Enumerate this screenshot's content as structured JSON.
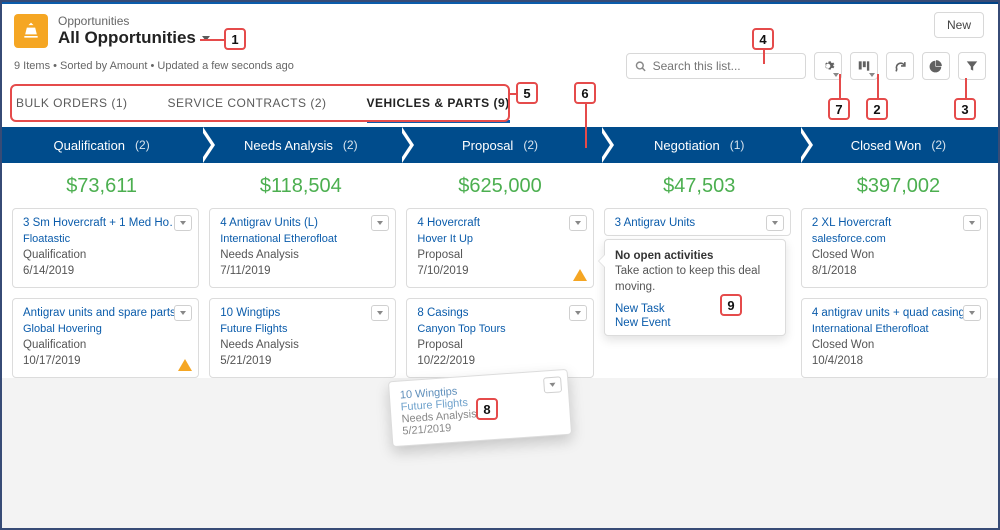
{
  "header": {
    "object_label": "Opportunities",
    "list_title": "All Opportunities",
    "new_button": "New"
  },
  "subheader": {
    "info": "9 Items • Sorted by Amount • Updated a few seconds ago",
    "search_placeholder": "Search this list..."
  },
  "tabs": [
    {
      "label": "BULK ORDERS (1)",
      "active": false
    },
    {
      "label": "SERVICE CONTRACTS (2)",
      "active": false
    },
    {
      "label": "VEHICLES & PARTS (9)",
      "active": true
    }
  ],
  "stages": [
    {
      "name": "Qualification",
      "count": "(2)",
      "total": "$73,611"
    },
    {
      "name": "Needs Analysis",
      "count": "(2)",
      "total": "$118,504"
    },
    {
      "name": "Proposal",
      "count": "(2)",
      "total": "$625,000"
    },
    {
      "name": "Negotiation",
      "count": "(1)",
      "total": "$47,503"
    },
    {
      "name": "Closed Won",
      "count": "(2)",
      "total": "$397,002"
    }
  ],
  "cards": {
    "qualification": [
      {
        "title": "3 Sm Hovercraft + 1 Med Ho…",
        "account": "Floatastic",
        "stage": "Qualification",
        "date": "6/14/2019",
        "warn": false
      },
      {
        "title": "Antigrav units and spare parts",
        "account": "Global Hovering",
        "stage": "Qualification",
        "date": "10/17/2019",
        "warn": true
      }
    ],
    "needs": [
      {
        "title": "4 Antigrav Units (L)",
        "account": "International Etherofloat",
        "stage": "Needs Analysis",
        "date": "7/11/2019",
        "warn": false
      },
      {
        "title": "10 Wingtips",
        "account": "Future Flights",
        "stage": "Needs Analysis",
        "date": "5/21/2019",
        "warn": false
      }
    ],
    "proposal": [
      {
        "title": "4 Hovercraft",
        "account": "Hover It Up",
        "stage": "Proposal",
        "date": "7/10/2019",
        "warn": true
      },
      {
        "title": "8 Casings",
        "account": "Canyon Top Tours",
        "stage": "Proposal",
        "date": "10/22/2019",
        "warn": false
      }
    ],
    "negotiation": [
      {
        "title": "3 Antigrav Units",
        "account": "",
        "stage": "",
        "date": "",
        "warn": false
      }
    ],
    "closed": [
      {
        "title": "2 XL Hovercraft",
        "account": "salesforce.com",
        "stage": "Closed Won",
        "date": "8/1/2018",
        "warn": false
      },
      {
        "title": "4 antigrav units + quad casing",
        "account": "International Etherofloat",
        "stage": "Closed Won",
        "date": "10/4/2018",
        "warn": false
      }
    ]
  },
  "hover_popup": {
    "title": "No open activities",
    "body": "Take action to keep this deal moving.",
    "link1": "New Task",
    "link2": "New Event"
  },
  "drag_card": {
    "title": "10 Wingtips",
    "account": "Future Flights",
    "stage": "Needs Analysis",
    "date": "5/21/2019"
  },
  "annotations": [
    "1",
    "2",
    "3",
    "4",
    "5",
    "6",
    "7",
    "8",
    "9"
  ]
}
